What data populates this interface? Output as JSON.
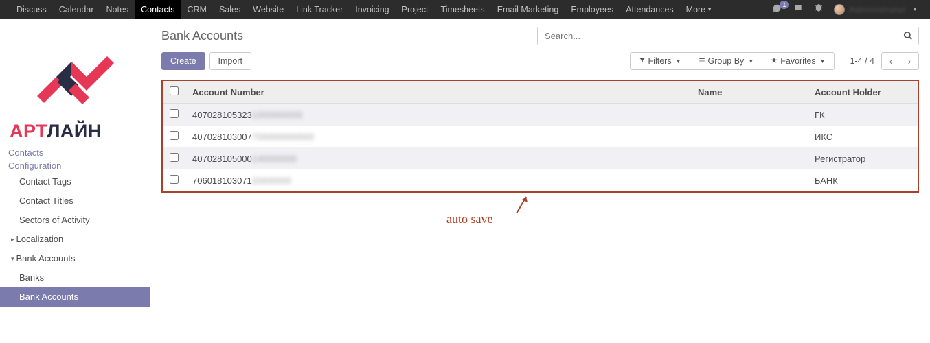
{
  "topnav": {
    "items": [
      "Discuss",
      "Calendar",
      "Notes",
      "Contacts",
      "CRM",
      "Sales",
      "Website",
      "Link Tracker",
      "Invoicing",
      "Project",
      "Timesheets",
      "Email Marketing",
      "Employees",
      "Attendances",
      "More"
    ],
    "active_index": 3,
    "badge_count": "1",
    "user_name": "Administrator"
  },
  "logo": {
    "text_a": "АРТ",
    "text_r": "ЛАЙН"
  },
  "sidebar": {
    "heading1": "Contacts",
    "heading2": "Configuration",
    "items": [
      {
        "label": "Contact Tags",
        "level": 2
      },
      {
        "label": "Contact Titles",
        "level": 2
      },
      {
        "label": "Sectors of Activity",
        "level": 2
      },
      {
        "label": "Localization",
        "level": 1,
        "caret": "right"
      },
      {
        "label": "Bank Accounts",
        "level": 1,
        "caret": "down"
      },
      {
        "label": "Banks",
        "level": 2
      },
      {
        "label": "Bank Accounts",
        "level": 2,
        "active": true
      }
    ]
  },
  "page": {
    "title": "Bank Accounts",
    "search_placeholder": "Search...",
    "create": "Create",
    "import": "Import",
    "filters": "Filters",
    "groupby": "Group By",
    "favorites": "Favorites",
    "pager": "1-4 / 4"
  },
  "table": {
    "cols": {
      "c0": "Account Number",
      "c1": "Name",
      "c2": "Account Holder"
    },
    "rows": [
      {
        "acc": "407028105323",
        "acc_tail": "100000000",
        "name": "",
        "holder": "ГК"
      },
      {
        "acc": "407028103007",
        "acc_tail": "70000000000",
        "name": "",
        "holder": "ИКС"
      },
      {
        "acc": "407028105000",
        "acc_tail": "14000000",
        "name": "",
        "holder": "Регистратор"
      },
      {
        "acc": "706018103071",
        "acc_tail": "2000000",
        "name": "",
        "holder": "БАНК"
      }
    ]
  },
  "annotation": {
    "text": "auto save"
  }
}
